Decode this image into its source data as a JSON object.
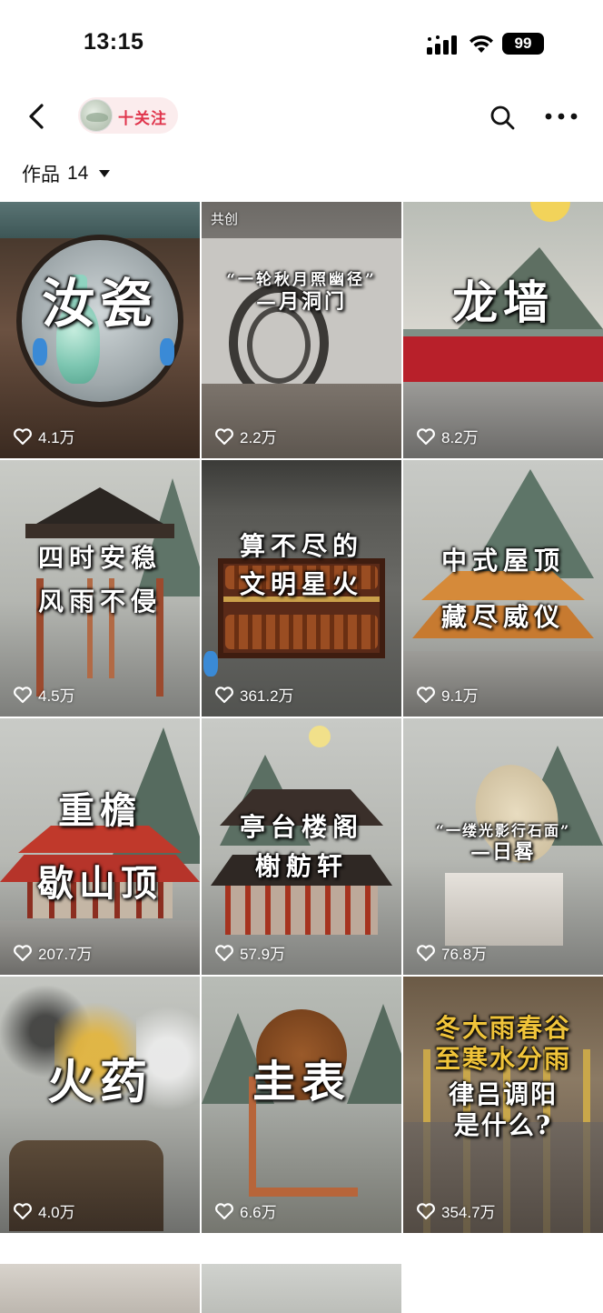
{
  "status": {
    "time": "13:15",
    "battery": "99"
  },
  "nav": {
    "follow_label": "十关注"
  },
  "works": {
    "label": "作品",
    "count": "14"
  },
  "tiles": [
    {
      "title_lines": [
        "汝瓷"
      ],
      "likes": "4.1万"
    },
    {
      "badge": "共创",
      "title_lines": [
        "“一轮秋月照幽径”",
        "—月洞门"
      ],
      "likes": "2.2万"
    },
    {
      "title_lines": [
        "龙墙"
      ],
      "likes": "8.2万"
    },
    {
      "title_lines": [
        "四时安稳",
        "风雨不侵"
      ],
      "likes": "4.5万"
    },
    {
      "title_lines": [
        "算不尽的",
        "文明星火"
      ],
      "likes": "361.2万"
    },
    {
      "title_lines": [
        "中式屋顶",
        "藏尽威仪"
      ],
      "likes": "9.1万"
    },
    {
      "title_lines": [
        "重檐",
        "歇山顶"
      ],
      "likes": "207.7万"
    },
    {
      "title_lines": [
        "亭台楼阁",
        "榭舫轩"
      ],
      "likes": "57.9万"
    },
    {
      "title_lines": [
        "“一缕光影行石面”",
        "—日晷"
      ],
      "likes": "76.8万"
    },
    {
      "title_lines": [
        "火药"
      ],
      "likes": "4.0万"
    },
    {
      "title_lines": [
        "圭表"
      ],
      "likes": "6.6万"
    },
    {
      "title_lines": [
        "冬大雨春谷",
        "至寒水分雨",
        "律吕调阳",
        "是什么?"
      ],
      "likes": "354.7万"
    }
  ]
}
